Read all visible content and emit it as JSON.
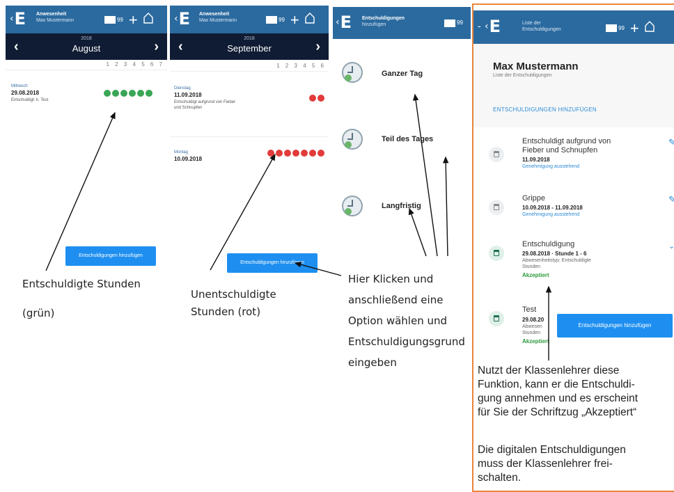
{
  "panel1": {
    "logo": "E",
    "title_line1": "Anwesenheit",
    "title_line2": "Max Mustermann",
    "mail_count": "99",
    "year": "2018",
    "month": "August",
    "hours": "1 2 3 4 5 6 7",
    "entry": {
      "day": "Mittwoch",
      "date": "29.08.2018",
      "note": "Entschuldigt: k. Test"
    },
    "dot_color": "#3aa655",
    "button": "Entschuldigungen hinzufügen"
  },
  "panel2": {
    "logo": "E",
    "title_line1": "Anwesenheit",
    "title_line2": "Max Mustermann",
    "mail_count": "99",
    "year": "2018",
    "month": "September",
    "hours": "1 2 3 4 5 6",
    "entry1": {
      "day": "Dienstag",
      "date": "11.09.2018",
      "note1": "Entschuldigt aufgrund von Fieber",
      "note2": "und Schnupfen"
    },
    "entry2": {
      "day": "Montag",
      "date": "10.09.2018"
    },
    "dot_color": "#e23b3b",
    "button": "Entschuldigungen hinzufügen"
  },
  "panel3": {
    "logo": "E",
    "title_line1": "Entschuldigungen",
    "title_line2": "hinzufügen",
    "mail_count": "99",
    "options": [
      "Ganzer Tag",
      "Teil des Tages",
      "Langfristig"
    ]
  },
  "panel4": {
    "logo": "E",
    "title_line1": "Liste der",
    "title_line2": "Entschuldigungen",
    "mail_count": "99",
    "name": "Max Mustermann",
    "subtitle": "Liste der Entschuldigungen",
    "add_link": "ENTSCHULDIGUNGEN HINZUFÜGEN",
    "items": [
      {
        "title1": "Entschuldigt aufgrund von",
        "title2": "Fieber und Schnupfen",
        "date": "11.09.2018",
        "status": "Genehmigung ausstehend"
      },
      {
        "title1": "Grippe",
        "date": "10.09.2018 - 11.09.2018",
        "status": "Genehmigung ausstehend"
      },
      {
        "title1": "Entschuldigung",
        "date": "29.08.2018 · Stunde 1 - 6",
        "type1": "Abwesenheitstyp: Entschuldigte",
        "type2": "Stunden",
        "accepted": "Akzeptiert"
      },
      {
        "title1": "Test",
        "date": "29.08.20",
        "type1": "Abwesen",
        "type2": "Stunden",
        "accepted": "Akzeptiert"
      }
    ],
    "button": "Entschuldigungen hinzufügen",
    "note1": [
      "Nutzt der Klassenlehrer diese",
      "Funktion, kann er die Entschuldi-",
      "gung annehmen und es erscheint",
      "für Sie der Schriftzug „Akzeptiert“"
    ],
    "note2": [
      "Die digitalen Entschuldigungen",
      "muss der Klassenlehrer frei-",
      "schalten."
    ]
  },
  "annotations": {
    "green_1": "Entschuldigte Stunden",
    "green_2": "(grün)",
    "red_1": "Unentschuldigte",
    "red_2": "Stunden (rot)",
    "click_1": "Hier Klicken und",
    "click_2": "anschließend eine",
    "click_3": "Option wählen und",
    "click_4": "Entschuldigungsgrund",
    "click_5": "eingeben"
  },
  "colors": {
    "appbar": "#2b6a9f",
    "datebar": "#0f1c33",
    "accent": "#1e8ff0",
    "highlight_border": "#e8843a",
    "green": "#3aa655",
    "red": "#e23b3b"
  }
}
